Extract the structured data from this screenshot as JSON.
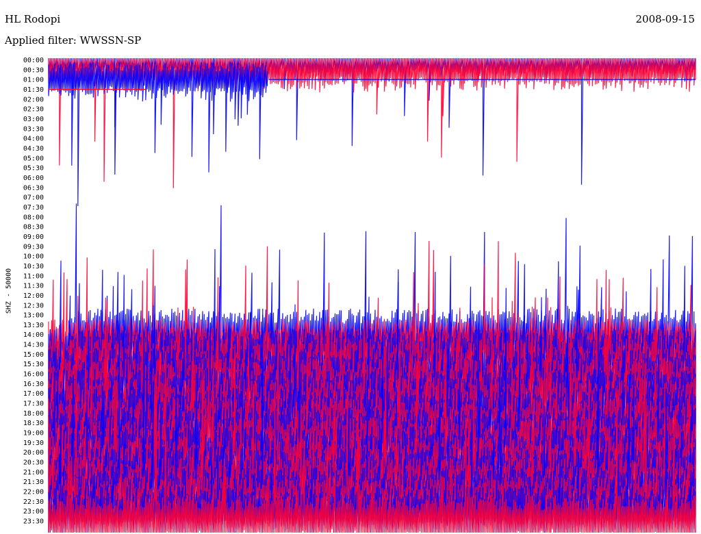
{
  "header": {
    "station": "HL Rodopi",
    "date": "2008-09-15",
    "filter": "Applied filter: WWSSN-SP",
    "channel": "SHZ - 50000"
  },
  "colors": {
    "trace_a": "#0000ff",
    "trace_b": "#ff0033",
    "background": "#ffffff"
  },
  "chart_data": {
    "type": "line",
    "title": "HL Rodopi",
    "subtitle": "Applied filter: WWSSN-SP",
    "ylabel": "SHZ - 50000",
    "date": "2008-09-15",
    "y_ticks": [
      "00:00",
      "00:30",
      "01:00",
      "01:30",
      "02:00",
      "02:30",
      "03:00",
      "03:30",
      "04:00",
      "04:30",
      "05:00",
      "05:30",
      "06:00",
      "06:30",
      "07:00",
      "07:30",
      "08:00",
      "08:30",
      "09:00",
      "09:30",
      "10:00",
      "10:30",
      "11:00",
      "11:30",
      "12:00",
      "12:30",
      "13:00",
      "13:30",
      "14:00",
      "14:30",
      "15:00",
      "15:30",
      "16:00",
      "16:30",
      "17:00",
      "17:30",
      "18:00",
      "18:30",
      "19:00",
      "19:30",
      "20:00",
      "20:30",
      "21:00",
      "21:30",
      "22:00",
      "22:30",
      "23:00",
      "23:30"
    ],
    "x_range_minutes": [
      0,
      30
    ],
    "grid": false,
    "legend": "none",
    "data_start_row": 28,
    "data_start_fraction": 0.03,
    "data_end_row": 2,
    "data_end_fraction": 0.34,
    "gap_intervals": [
      {
        "start_row": 2,
        "start_fraction": 0.34,
        "end_row": 3,
        "end_fraction": 0.15
      }
    ],
    "color_cycle": [
      "trace_a",
      "trace_b"
    ]
  }
}
